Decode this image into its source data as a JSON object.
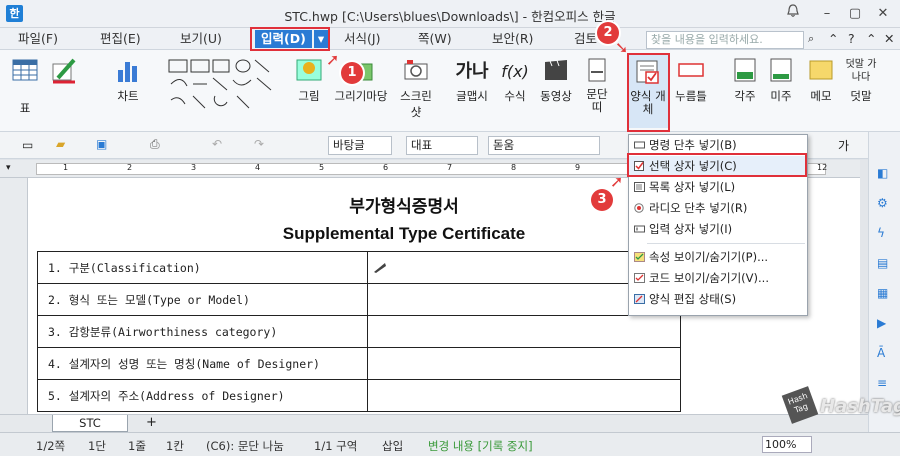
{
  "window": {
    "title": "STC.hwp [C:\\Users\\blues\\Downloads\\] - 한컴오피스 한글",
    "app_icon": "hwp-logo-icon",
    "min": "–",
    "max": "▢",
    "close": "✕",
    "help": "?",
    "bell": "🔔"
  },
  "menubar": {
    "items": [
      "파일(F)",
      "편집(E)",
      "보기(U)",
      "입력(D)",
      "서식(J)",
      "쪽(W)",
      "보안(R)",
      "검토"
    ],
    "active": "입력(D)",
    "search_placeholder": "찾을 내용을 입력하세요.",
    "search_icon": "search-icon"
  },
  "ribbon": {
    "table": "표",
    "chart": "차트",
    "picture": "그림",
    "drawing_market": "그리기마당",
    "screenshot": "스크린 샷",
    "letter_art": "글맵시",
    "formula": "수식",
    "video": "동영상",
    "paragraph_frame": "문단 띠",
    "form_object": "양식 개체",
    "push_button": "누름틀",
    "footnote": "각주",
    "endnote": "미주",
    "memo": "메모",
    "overlay": "덧말",
    "overlay_icon_text": "덧말 가나다",
    "letter_art_icon_text": "가나",
    "formula_icon_text": "f(x)"
  },
  "toolbar2": {
    "style": "바탕글",
    "font_kind": "대표",
    "font": "돋움",
    "font_prefix": "가",
    "font_type_prefix": "가"
  },
  "ruler": {
    "numbers": [
      "1",
      "2",
      "3",
      "4",
      "5",
      "6",
      "7",
      "8",
      "9",
      "10",
      "11",
      "12"
    ]
  },
  "document": {
    "title_ko": "부가형식증명서",
    "title_en": "Supplemental Type Certificate",
    "rows": [
      "1. 구분(Classification)",
      "2. 형식 또는 모델(Type or Model)",
      "3. 감항분류(Airworthiness category)",
      "4. 설계자의 성명 또는 명칭(Name of Designer)",
      "5. 설계자의 주소(Address of Designer)"
    ]
  },
  "dropdown": {
    "items": [
      {
        "label": "명령 단추 넣기(B)",
        "icon": "command-button-icon"
      },
      {
        "label": "선택 상자 넣기(C)",
        "icon": "checkbox-icon"
      },
      {
        "label": "목록 상자 넣기(L)",
        "icon": "listbox-icon"
      },
      {
        "label": "라디오 단추 넣기(R)",
        "icon": "radio-button-icon"
      },
      {
        "label": "입력 상자 넣기(I)",
        "icon": "input-box-icon"
      },
      {
        "label": "속성 보이기/숨기기(P)...",
        "icon": "properties-icon"
      },
      {
        "label": "코드 보이기/숨기기(V)...",
        "icon": "code-icon"
      },
      {
        "label": "양식 편집 상태(S)",
        "icon": "form-edit-icon"
      }
    ],
    "highlighted": "선택 상자 넣기(C)"
  },
  "tabs": {
    "sheet": "STC",
    "add": "+"
  },
  "status": {
    "page": "1/2쪽",
    "column": "1단",
    "line": "1줄",
    "col": "1칸",
    "para": "(C6): 문단 나눔",
    "section": "1/1 구역",
    "insert": "삽입",
    "track": "변경 내용 [기록 중지]",
    "zoom": "100%"
  },
  "annotations": {
    "step1": "1",
    "step2": "2",
    "step3": "3"
  },
  "watermark": {
    "line1": "Hash",
    "line2": "Tag",
    "brand": "HashTag"
  },
  "colors": {
    "accent": "#2a7bd4",
    "highlight": "#e0303a",
    "status_green": "#3a9a3a"
  }
}
